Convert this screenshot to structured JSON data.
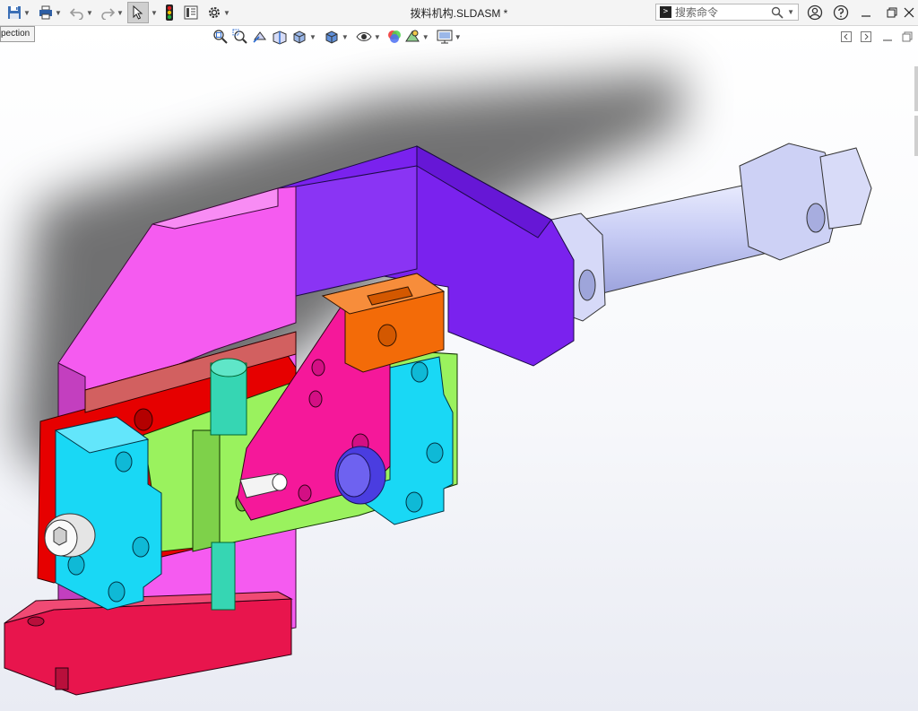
{
  "window": {
    "title": "拨料机构.SLDASM *"
  },
  "search": {
    "placeholder": "搜索命令",
    "prompt_glyph": ">"
  },
  "tooltip": {
    "text": "pection"
  },
  "toolbar": {
    "left_icons": [
      "save-icon",
      "print-icon",
      "undo-icon",
      "redo-icon",
      "select-arrow-icon",
      "traffic-light-icon",
      "file-properties-icon",
      "gear-icon"
    ],
    "hud_icons": [
      "zoom-to-fit-icon",
      "zoom-area-icon",
      "previous-view-icon",
      "section-view-icon",
      "view-orientation-icon",
      "display-style-icon",
      "hide-show-icon",
      "edit-appearance-icon",
      "apply-scene-icon",
      "view-settings-icon"
    ]
  },
  "window_controls": [
    "help-user-icon",
    "help-icon",
    "minimize-icon",
    "restore-icon",
    "close-icon"
  ],
  "colors": {
    "magenta": "#f55bf0",
    "violet": "#7a22ee",
    "red": "#e60000",
    "cyan": "#19d8f5",
    "green": "#9af25e",
    "orange": "#f36b08",
    "pink": "#f5189a",
    "cylinder": "#c9cdf6",
    "crimson": "#e8154d",
    "pin": "#36d6b3",
    "knob": "#5a4dee"
  }
}
